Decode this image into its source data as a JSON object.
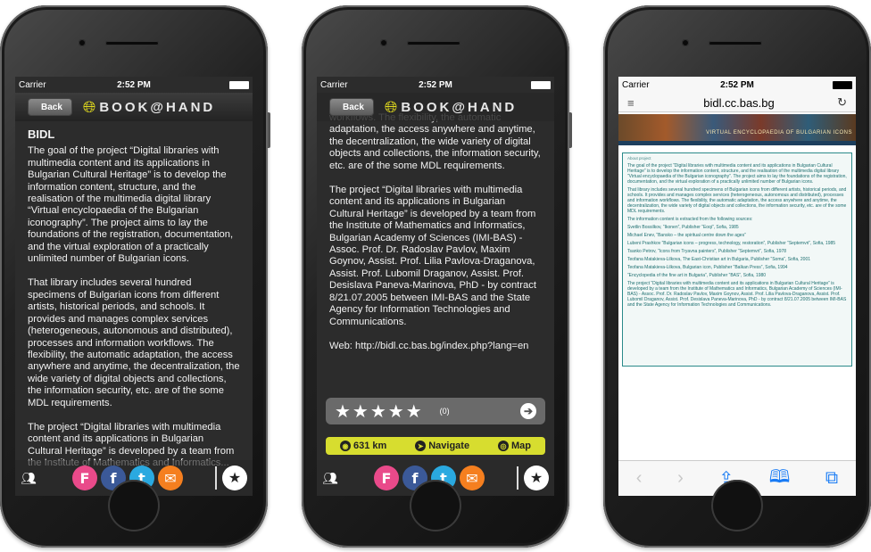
{
  "status": {
    "carrier": "Carrier",
    "time": "2:52 PM"
  },
  "app": {
    "back_label": "Back",
    "brand": "BOOK@HAND"
  },
  "article": {
    "title": "BIDL",
    "p1": "The goal of the project “Digital libraries with multimedia content and its applications in Bulgarian Cultural Heritage” is to develop the information content, structure, and the realisation of the multimedia digital library “Virtual encyclopaedia of the Bulgarian iconography”. The project aims to lay the foundations of the registration, documentation, and the virtual exploration of a practically unlimited number of Bulgarian icons.",
    "p2": "That library includes several hundred specimens of Bulgarian icons from different artists, historical periods, and schools. It provides and manages complex services (heterogeneous, autonomous and distributed), processes and information workflows. The flexibility, the automatic adaptation, the access anywhere and anytime, the decentralization, the wide variety of digital objects and collections, the information security, etc. are of the some MDL requirements.",
    "p3": "The project “Digital libraries with multimedia content and its applications in Bulgarian Cultural Heritage” is developed by a team from the Institute of Mathematics and Informatics...",
    "p2_tail": "workflows. The flexibility, the automatic adaptation, the access anywhere and anytime, the decentralization, the wide variety of digital objects and collections, the information security, etc. are of the some MDL requirements.",
    "p3_full": "The project “Digital libraries with multimedia content and its applications in Bulgarian Cultural Heritage” is developed by a team from the Institute of Mathematics and Informatics, Bulgarian Academy of Sciences (IMI-BAS) - Assoc. Prof. Dr. Radoslav Pavlov, Maxim Goynov, Assist. Prof. Lilia Pavlova-Draganova, Assist. Prof. Lubomil Draganov, Assist. Prof. Desislava Paneva-Marinova, PhD - by contract 8/21.07.2005 between IMI-BAS and the State Agency for Information Technologies and Communications.",
    "web": "Web: http://bidl.cc.bas.bg/index.php?lang=en"
  },
  "rating": {
    "stars": "★★★★★",
    "count": "(0)"
  },
  "actions": {
    "distance": "631 km",
    "navigate": "Navigate",
    "map": "Map"
  },
  "share": {
    "foursquare": "F",
    "facebook": "f",
    "twitter": "t",
    "mail": "✉",
    "star": "★"
  },
  "safari": {
    "url": "bidl.cc.bas.bg",
    "banner_text": "VIRTUAL ENCYCLOPAEDIA OF BULGARIAN ICONS",
    "box_header": "About project",
    "box_p1": "The goal of the project “Digital libraries with multimedia content and its applications in Bulgarian Cultural Heritage” is to develop the information content, structure, and the realisation of the multimedia digital library “Virtual encyclopaedia of the Bulgarian iconography”. The project aims to lay the foundations of the registration, documentation, and the virtual exploration of a practically unlimited number of Bulgarian icons.",
    "box_p2": "That library includes several hundred specimens of Bulgarian icons from different artists, historical periods, and schools. It provides and manages complex services (heterogeneous, autonomous and distributed), processes and information workflows. The flexibility, the automatic adaptation, the access anywhere and anytime, the decentralization, the wide variety of digital objects and collections, the information security, etc. are of the some MDL requirements.",
    "box_p3": "The information content is extracted from the following sources:",
    "box_p4": "Svetlin Bossilkov, “Ikonen”, Publisher “Eoqi”, Sofia, 1985",
    "box_p5": "Michael Enev, “Bansko – the spiritual centre down the ages”",
    "box_p6": "Lubeni Prashkov “Bulgarian icons – progress, technology, restoration”, Publisher “Septemvri”, Sofia, 1985",
    "box_p7": "Tsanko Petrov, “Icons from Tryavna painters”, Publisher “Septemvri”, Sofia, 1978",
    "box_p8": "Teofana Matakieva-Lilkova, The East-Christian art in Bulgaria, Publisher “Soma”, Sofia, 2001",
    "box_p9": "Teofana Matakieva-Lilkova, Bulgarian icon, Publisher “Balkan Press”, Sofia, 1994",
    "box_p10": "“Encyclopedia of the fine art in Bulgaria”, Publisher “BAS”, Sofia, 1980",
    "box_p11": "The project “Digital libraries with multimedia content and its applications in Bulgarian Cultural Heritage” is developed by a team from the Institute of Mathematics and Informatics, Bulgarian Academy of Sciences (IMI-BAS) - Assoc. Prof. Dr. Radoslav Pavlov, Maxim Goynov, Assist. Prof. Lilia Pavlova-Draganova, Assist. Prof. Lubomil Draganov, Assist. Prof. Desislava Paneva-Marinova, PhD - by contract 8/21.07.2005 between IMI-BAS and the State Agency for Information Technologies and Communications."
  }
}
